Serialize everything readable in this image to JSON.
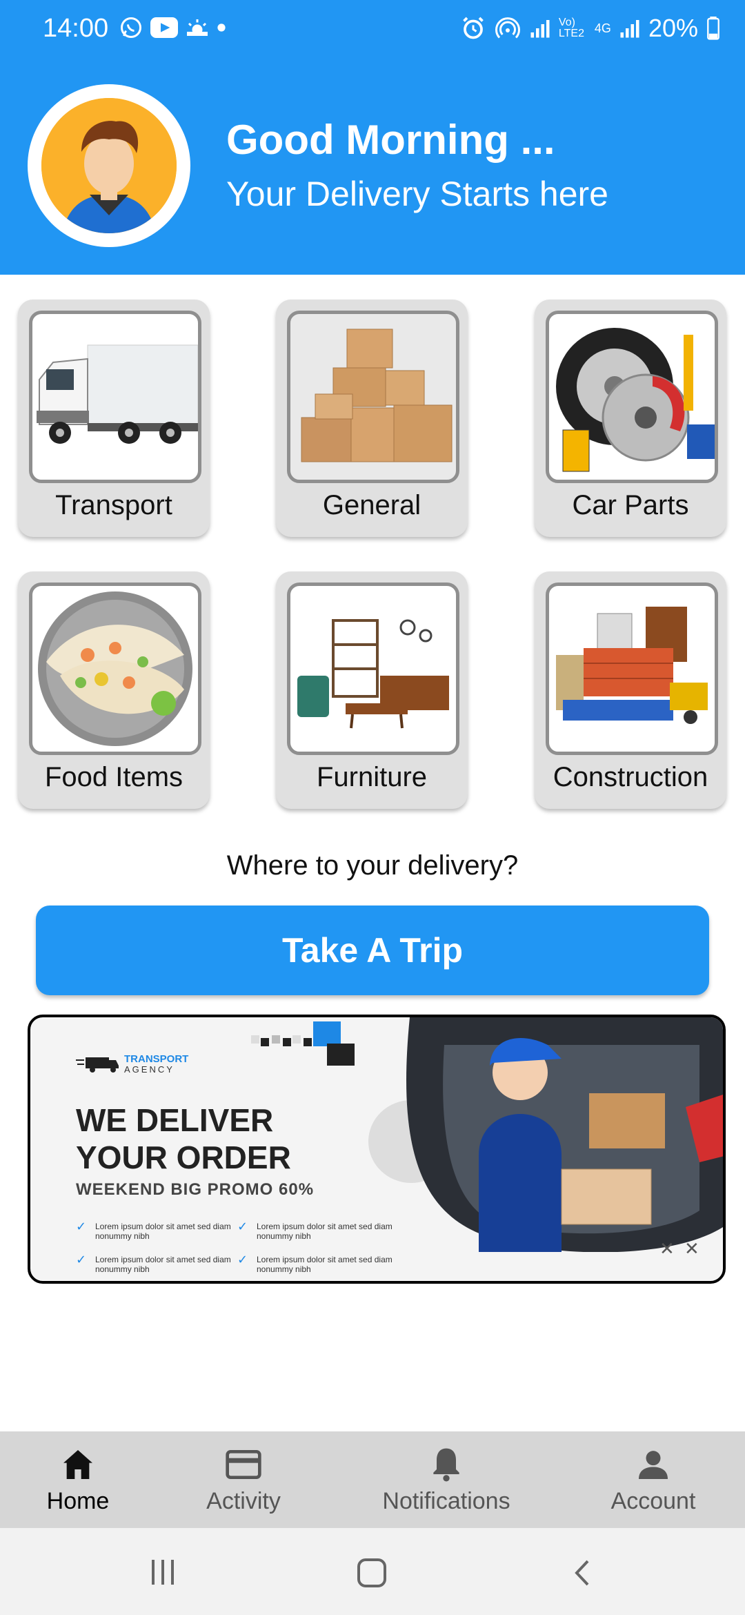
{
  "status_bar": {
    "time": "14:00",
    "network_label": "Vo) LTE2",
    "network_type": "4G",
    "battery": "20%"
  },
  "header": {
    "greeting": "Good Morning ...",
    "subtitle": "Your Delivery Starts here",
    "accent_color": "#2196F3"
  },
  "categories": [
    {
      "label": "Transport",
      "icon": "truck-image"
    },
    {
      "label": "General",
      "icon": "boxes-image"
    },
    {
      "label": "Car Parts",
      "icon": "car-parts-image"
    },
    {
      "label": "Food Items",
      "icon": "food-image"
    },
    {
      "label": "Furniture",
      "icon": "furniture-image"
    },
    {
      "label": "Construction",
      "icon": "construction-image"
    }
  ],
  "prompt": "Where to your delivery?",
  "trip_button": "Take A Trip",
  "banner": {
    "brand_name": "TRANSPORT",
    "brand_sub": "AGENCY",
    "headline_line1": "WE DELIVER",
    "headline_line2": "YOUR ORDER",
    "promo": "WEEKEND BIG PROMO 60%",
    "bullets": [
      "Lorem ipsum dolor sit amet sed diam nonummy nibh",
      "Lorem ipsum dolor sit amet sed diam nonummy nibh",
      "Lorem ipsum dolor sit amet sed diam nonummy nibh",
      "Lorem ipsum dolor sit amet sed diam nonummy nibh"
    ]
  },
  "bottom_nav": [
    {
      "label": "Home",
      "icon": "home-icon",
      "active": true
    },
    {
      "label": "Activity",
      "icon": "card-icon",
      "active": false
    },
    {
      "label": "Notifications",
      "icon": "bell-icon",
      "active": false
    },
    {
      "label": "Account",
      "icon": "person-icon",
      "active": false
    }
  ]
}
